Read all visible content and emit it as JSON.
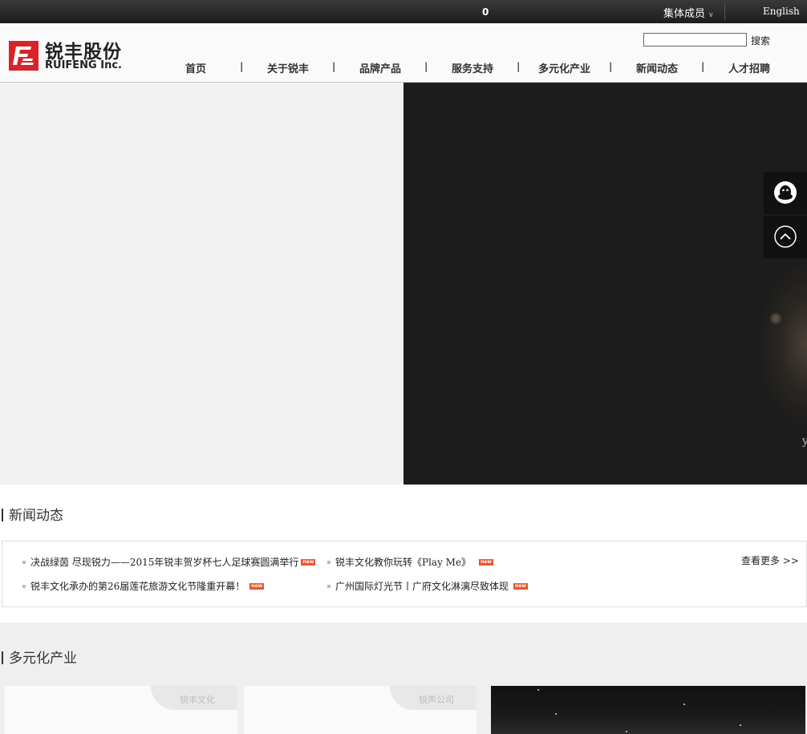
{
  "topbar": {
    "count": "0",
    "members_label": "集体成员",
    "language": "English"
  },
  "header": {
    "logo_name": "锐丰股份",
    "logo_sub": "RUIFENG Inc.",
    "search_placeholder": "",
    "search_button": "搜索",
    "nav": [
      {
        "label": "首页"
      },
      {
        "label": "关于锐丰"
      },
      {
        "label": "品牌产品"
      },
      {
        "label": "服务支持"
      },
      {
        "label": "多元化产业"
      },
      {
        "label": "新闻动态"
      },
      {
        "label": "人才招聘"
      }
    ],
    "nav_divider": "|"
  },
  "banner": {
    "partial_text": "y"
  },
  "news": {
    "title": "新闻动态",
    "badge": "new",
    "more": "查看更多 >>",
    "items": [
      {
        "text": "决战绿茵 尽现锐力——2015年锐丰贺岁杯七人足球赛圆满举行"
      },
      {
        "text": "锐丰文化教你玩转《Play Me》"
      },
      {
        "text": "锐丰文化承办的第26届莲花旅游文化节隆重开幕！"
      },
      {
        "text": "广州国际灯光节丨广府文化淋漓尽致体现"
      }
    ]
  },
  "industry": {
    "title": "多元化产业",
    "cards": [
      {
        "label": "锐丰文化"
      },
      {
        "label": "锐声公司"
      }
    ]
  },
  "colors": {
    "brand_red": "#d8232a",
    "badge_orange": "#e8572d",
    "topbar": "#2a2a2a"
  }
}
